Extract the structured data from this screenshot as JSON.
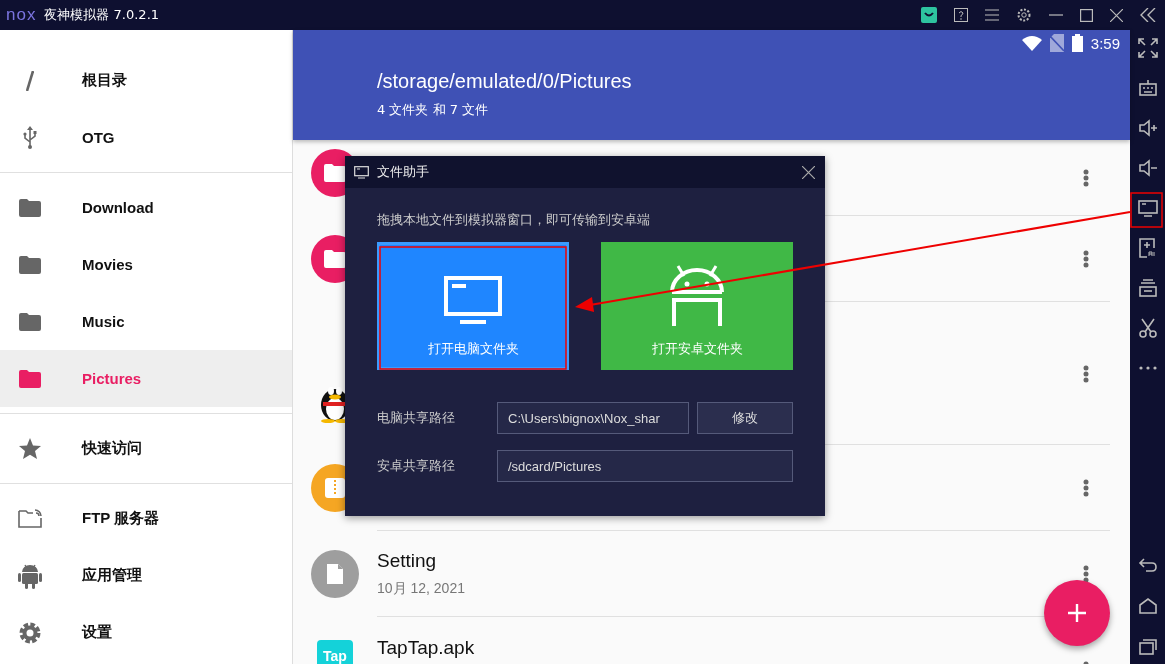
{
  "window": {
    "logo": "nox",
    "title": "夜神模拟器 7.0.2.1"
  },
  "status_bar": {
    "time": "3:59"
  },
  "sidebar": {
    "sections": [
      [
        {
          "kind": "slash",
          "label": "根目录",
          "selected": false
        },
        {
          "kind": "usb",
          "label": "OTG",
          "selected": false
        }
      ],
      [
        {
          "kind": "folder",
          "label": "Download",
          "selected": false
        },
        {
          "kind": "folder",
          "label": "Movies",
          "selected": false
        },
        {
          "kind": "folder",
          "label": "Music",
          "selected": false
        },
        {
          "kind": "folder",
          "label": "Pictures",
          "selected": true
        }
      ],
      [
        {
          "kind": "star",
          "label": "快速访问",
          "selected": false
        }
      ],
      [
        {
          "kind": "ftp",
          "label": "FTP 服务器",
          "selected": false
        },
        {
          "kind": "android",
          "label": "应用管理",
          "selected": false
        },
        {
          "kind": "gear",
          "label": "设置",
          "selected": false
        }
      ]
    ]
  },
  "header": {
    "path": "/storage/emulated/0/Pictures",
    "summary": "4 文件夹 和 7 文件"
  },
  "files": [
    {
      "kind": "folder"
    },
    {
      "kind": "folder"
    },
    {
      "kind": "penguin"
    },
    {
      "kind": "archive"
    },
    {
      "kind": "document",
      "name": "Setting",
      "date": "10月 12, 2021"
    },
    {
      "kind": "app",
      "icon_text": "Tap",
      "name": "TapTap.apk"
    }
  ],
  "dialog": {
    "title": "文件助手",
    "hint": "拖拽本地文件到模拟器窗口，即可传输到安卓端",
    "actions": [
      {
        "kind": "pc",
        "label": "打开电脑文件夹",
        "selected": true
      },
      {
        "kind": "android",
        "label": "打开安卓文件夹",
        "selected": false
      }
    ],
    "fields": [
      {
        "label": "电脑共享路径",
        "value": "C:\\Users\\bignox\\Nox_shar",
        "button": "修改"
      },
      {
        "label": "安卓共享路径",
        "value": "/sdcard/Pictures"
      }
    ]
  }
}
